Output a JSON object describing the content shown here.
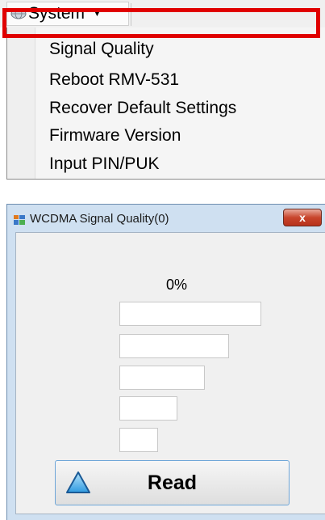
{
  "menubar": {
    "system_label": "System",
    "items": [
      {
        "label": "Signal Quality"
      },
      {
        "label": "Reboot RMV-531"
      },
      {
        "label": "Recover Default Settings"
      },
      {
        "label": "Firmware Version"
      },
      {
        "label": "Input PIN/PUK"
      }
    ],
    "highlight_color": "#e00000"
  },
  "dialog": {
    "title": "WCDMA Signal Quality(0)",
    "close_symbol": "x",
    "signal_percent": "0%",
    "read_label": "Read"
  },
  "icons": {
    "system": "globe-icon",
    "app": "window-app-icon",
    "read": "triangle-up-icon"
  }
}
